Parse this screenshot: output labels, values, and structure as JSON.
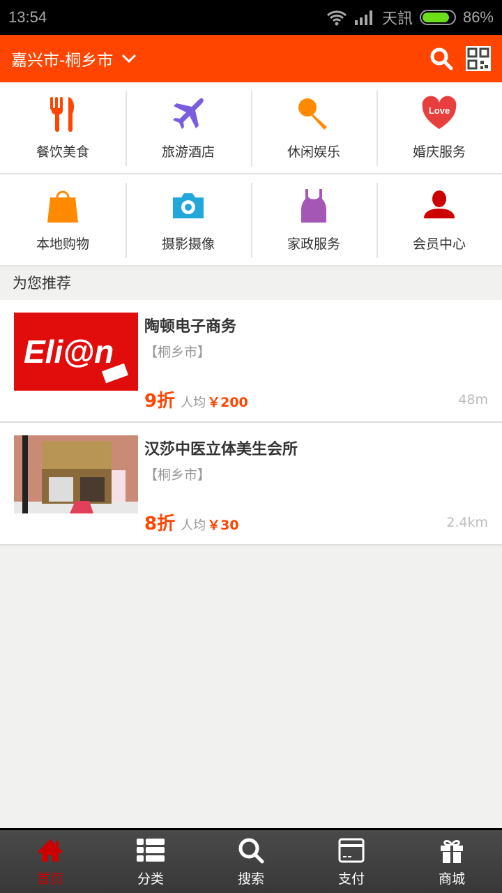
{
  "status": {
    "time": "13:54",
    "carrier": "天訊",
    "battery": "86%",
    "battery_level": 86
  },
  "header": {
    "location": "嘉兴市-桐乡市"
  },
  "categories": [
    {
      "label": "餐饮美食",
      "icon": "fork-knife-icon",
      "color": "#ff4500"
    },
    {
      "label": "旅游酒店",
      "icon": "airplane-icon",
      "color": "#7a5ce0"
    },
    {
      "label": "休闲娱乐",
      "icon": "microphone-icon",
      "color": "#ff8a00"
    },
    {
      "label": "婚庆服务",
      "icon": "love-heart-icon",
      "color": "#e83e3e",
      "icon_text": "Love"
    },
    {
      "label": "本地购物",
      "icon": "shopping-bag-icon",
      "color": "#ff8a00"
    },
    {
      "label": "摄影摄像",
      "icon": "camera-icon",
      "color": "#22a8d8"
    },
    {
      "label": "家政服务",
      "icon": "dress-icon",
      "color": "#a557b5"
    },
    {
      "label": "会员中心",
      "icon": "user-icon",
      "color": "#cc0000"
    }
  ],
  "section_title": "为您推荐",
  "listings": [
    {
      "name": "陶顿电子商务",
      "area": "【桐乡市】",
      "discount": "9折",
      "per_label": "人均",
      "price": "￥200",
      "distance": "48m",
      "thumb_text": "Eli@n"
    },
    {
      "name": "汉莎中医立体美生会所",
      "area": "【桐乡市】",
      "discount": "8折",
      "per_label": "人均",
      "price": "￥30",
      "distance": "2.4km"
    }
  ],
  "nav": [
    {
      "label": "首页",
      "icon": "home-icon",
      "active": true
    },
    {
      "label": "分类",
      "icon": "list-icon"
    },
    {
      "label": "搜索",
      "icon": "search-icon"
    },
    {
      "label": "支付",
      "icon": "card-icon"
    },
    {
      "label": "商城",
      "icon": "gift-icon"
    }
  ],
  "colors": {
    "brand": "#ff4500",
    "active_tab": "#cc0000"
  }
}
